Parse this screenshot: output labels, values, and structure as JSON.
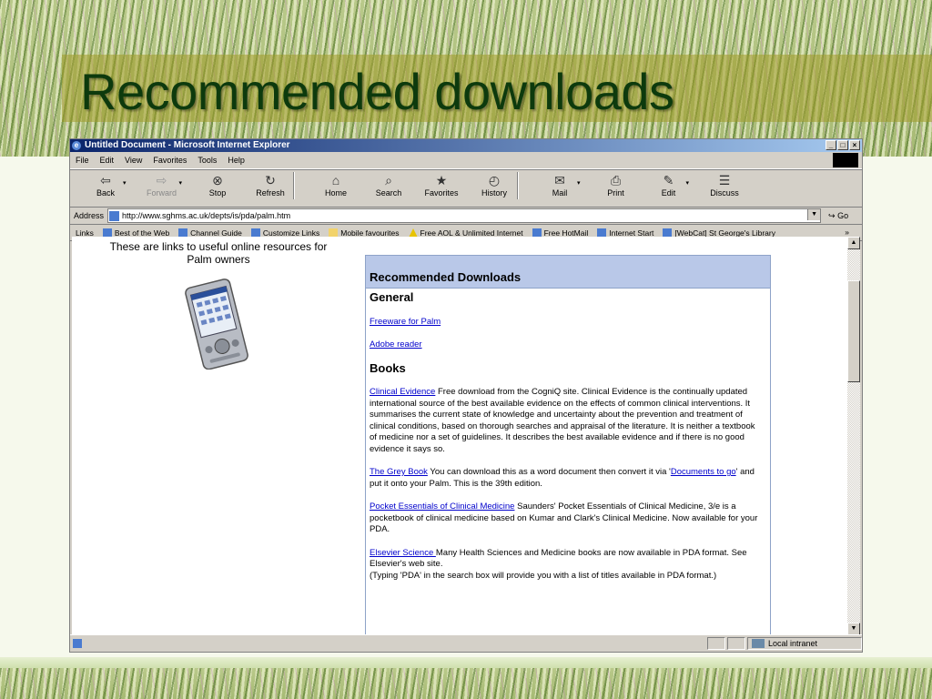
{
  "slide": {
    "title": "Recommended downloads"
  },
  "browser": {
    "title": "Untitled Document - Microsoft Internet Explorer",
    "window_buttons": [
      "_",
      "□",
      "×"
    ],
    "menu": [
      "File",
      "Edit",
      "View",
      "Favorites",
      "Tools",
      "Help"
    ],
    "toolbar": [
      {
        "label": "Back",
        "icon": "back-arrow-icon",
        "glyph": "⇦",
        "enabled": true,
        "dropdown": true
      },
      {
        "label": "Forward",
        "icon": "forward-arrow-icon",
        "glyph": "⇨",
        "enabled": false,
        "dropdown": true
      },
      {
        "label": "Stop",
        "icon": "stop-icon",
        "glyph": "⊗",
        "enabled": true
      },
      {
        "label": "Refresh",
        "icon": "refresh-icon",
        "glyph": "↻",
        "enabled": true
      },
      {
        "label": "Home",
        "icon": "home-icon",
        "glyph": "⌂",
        "enabled": true
      },
      {
        "label": "Search",
        "icon": "search-icon",
        "glyph": "⌕",
        "enabled": true
      },
      {
        "label": "Favorites",
        "icon": "favorites-icon",
        "glyph": "★",
        "enabled": true
      },
      {
        "label": "History",
        "icon": "history-icon",
        "glyph": "◴",
        "enabled": true
      },
      {
        "label": "Mail",
        "icon": "mail-icon",
        "glyph": "✉",
        "enabled": true,
        "dropdown": true
      },
      {
        "label": "Print",
        "icon": "print-icon",
        "glyph": "⎙",
        "enabled": true
      },
      {
        "label": "Edit",
        "icon": "edit-icon",
        "glyph": "✎",
        "enabled": true,
        "dropdown": true
      },
      {
        "label": "Discuss",
        "icon": "discuss-icon",
        "glyph": "☰",
        "enabled": true
      }
    ],
    "address": {
      "label": "Address",
      "url": "http://www.sghms.ac.uk/depts/is/pda/palm.htm",
      "go": "Go"
    },
    "links": {
      "label": "Links",
      "items": [
        "Best of the Web",
        "Channel Guide",
        "Customize Links",
        "Mobile favourites",
        "Free AOL & Unlimited Internet",
        "Free HotMail",
        "Internet Start",
        "[WebCat] St George's Library"
      ]
    },
    "status": {
      "zone": "Local intranet"
    }
  },
  "page": {
    "intro": "These are links to useful online resources for Palm owners",
    "panel_title": "Recommended Downloads",
    "general_heading": "General",
    "freeware_link": "Freeware for Palm",
    "adobe_link": "Adobe reader",
    "books_heading": "Books",
    "clinical_link": "Clinical Evidence",
    "clinical_text": " Free download from the CogniQ site. Clinical Evidence is the continually updated international source of the best available evidence on the effects of common clinical interventions. It summarises the current state of knowledge and uncertainty about the prevention and treatment of clinical conditions, based on thorough searches and appraisal of the literature. It is neither a textbook of medicine nor a set of guidelines. It describes the best available evidence and if there is no good evidence it says so.",
    "grey_link": "The Grey Book",
    "grey_text_1": " You can download this as a word document then convert it via '",
    "docs_link": "Documents to go",
    "grey_text_2": "' and put it onto your Palm. This is the 39th edition.",
    "pocket_link": "Pocket Essentials of Clinical Medicine",
    "pocket_text": " Saunders' Pocket Essentials of Clinical Medicine, 3/e is a pocketbook of clinical medicine based on Kumar and Clark's Clinical Medicine. Now available for your PDA.",
    "elsevier_link": "Elsevier Science ",
    "elsevier_text": "Many Health Sciences and Medicine  books are now available in PDA format. See Elsevier's web site.",
    "elsevier_note": "(Typing 'PDA' in the search box will provide you with a list of titles available in PDA format.)"
  }
}
